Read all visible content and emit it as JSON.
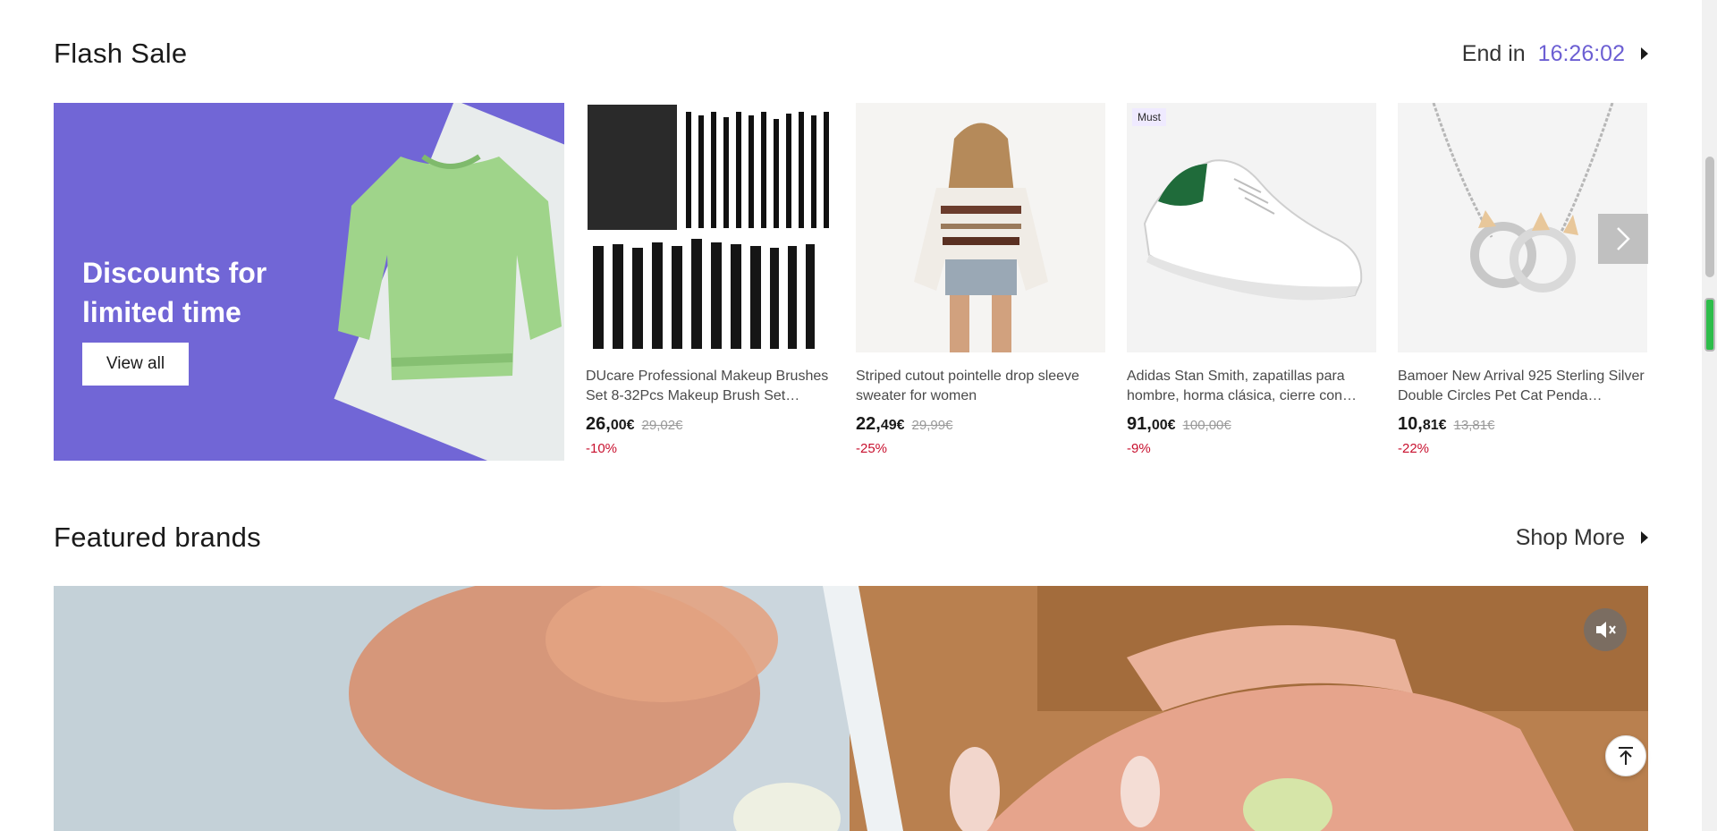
{
  "flash_sale": {
    "title": "Flash Sale",
    "end_label": "End in",
    "countdown": "16:26:02",
    "promo": {
      "title_line1": "Discounts for",
      "title_line2": "limited time",
      "button": "View all",
      "bg_color": "#7166d6"
    },
    "products": [
      {
        "name": "DUcare Professional Makeup Brushes Set 8-32Pcs Makeup Brush Set…",
        "price_int": "26,",
        "price_dec": "00€",
        "old_price": "29,02€",
        "discount": "-10%",
        "image_icon": "makeup-brushes-image"
      },
      {
        "name": "Striped cutout pointelle drop sleeve sweater for women",
        "price_int": "22,",
        "price_dec": "49€",
        "old_price": "29,99€",
        "discount": "-25%",
        "image_icon": "striped-sweater-image"
      },
      {
        "name": "Adidas Stan Smith, zapatillas para hombre, horma clásica, cierre con…",
        "price_int": "91,",
        "price_dec": "00€",
        "old_price": "100,00€",
        "discount": "-9%",
        "tag": "Must",
        "image_icon": "sneaker-image"
      },
      {
        "name": "Bamoer New Arrival 925 Sterling Silver Double Circles Pet Cat Penda…",
        "price_int": "10,",
        "price_dec": "81€",
        "old_price": "13,81€",
        "discount": "-22%",
        "image_icon": "necklace-image"
      }
    ]
  },
  "featured_brands": {
    "title": "Featured brands",
    "shop_more": "Shop More"
  },
  "colors": {
    "accent": "#6c5fd3",
    "discount": "#c8102e"
  }
}
